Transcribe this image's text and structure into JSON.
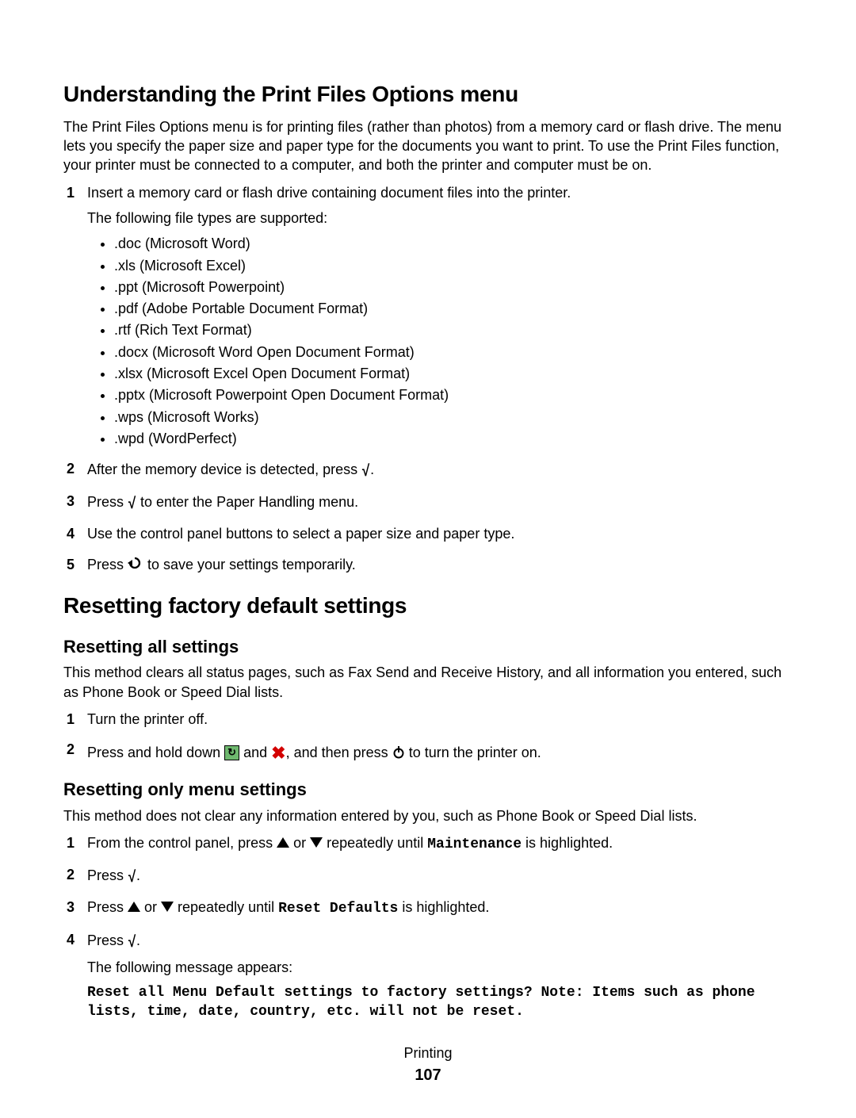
{
  "section1": {
    "heading": "Understanding the Print Files Options menu",
    "intro": "The Print Files Options menu is for printing files (rather than photos) from a memory card or flash drive. The menu lets you specify the paper size and paper type for the documents you want to print. To use the Print Files function, your printer must be connected to a computer, and both the printer and computer must be on.",
    "step1": "Insert a memory card or flash drive containing document files into the printer.",
    "supported_label": "The following file types are supported:",
    "types": [
      ".doc (Microsoft Word)",
      ".xls (Microsoft Excel)",
      ".ppt (Microsoft Powerpoint)",
      ".pdf (Adobe Portable Document Format)",
      ".rtf (Rich Text Format)",
      ".docx (Microsoft Word Open Document Format)",
      ".xlsx (Microsoft Excel Open Document Format)",
      ".pptx (Microsoft Powerpoint Open Document Format)",
      ".wps (Microsoft Works)",
      ".wpd (WordPerfect)"
    ],
    "step2_a": "After the memory device is detected, press ",
    "step2_b": ".",
    "step3_a": "Press ",
    "step3_b": " to enter the Paper Handling menu.",
    "step4": "Use the control panel buttons to select a paper size and paper type.",
    "step5_a": "Press ",
    "step5_b": " to save your settings temporarily."
  },
  "section2": {
    "heading": "Resetting factory default settings",
    "sub1": {
      "heading": "Resetting all settings",
      "intro": "This method clears all status pages, such as Fax Send and Receive History, and all information you entered, such as Phone Book or Speed Dial lists.",
      "step1": "Turn the printer off.",
      "step2_a": "Press and hold down ",
      "step2_b": " and ",
      "step2_c": ", and then press ",
      "step2_d": " to turn the printer on."
    },
    "sub2": {
      "heading": "Resetting only menu settings",
      "intro": "This method does not clear any information entered by you, such as Phone Book or Speed Dial lists.",
      "step1_a": "From the control panel, press ",
      "step1_b": " or ",
      "step1_c": " repeatedly until ",
      "step1_mono": "Maintenance",
      "step1_d": " is highlighted.",
      "step2_a": "Press ",
      "step2_b": ".",
      "step3_a": "Press ",
      "step3_b": " or ",
      "step3_c": " repeatedly until ",
      "step3_mono": "Reset Defaults",
      "step3_d": " is highlighted.",
      "step4_a": "Press ",
      "step4_b": ".",
      "msg_label": "The following message appears:",
      "msg": "Reset all Menu Default settings to factory settings? Note: Items such as phone lists, time, date, country, etc. will not be reset."
    }
  },
  "footer": {
    "section": "Printing",
    "page": "107"
  }
}
